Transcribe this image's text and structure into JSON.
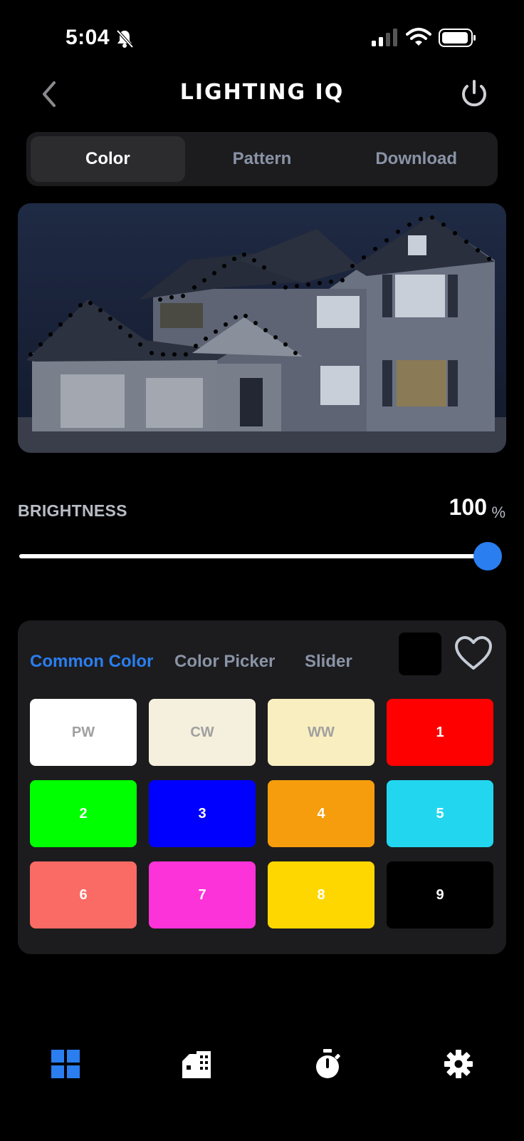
{
  "status_bar": {
    "time": "5:04"
  },
  "header": {
    "title": "LIGHTING IQ"
  },
  "mode_tabs": [
    {
      "label": "Color",
      "active": true
    },
    {
      "label": "Pattern",
      "active": false
    },
    {
      "label": "Download",
      "active": false
    }
  ],
  "brightness": {
    "label": "BRIGHTNESS",
    "value": "100",
    "unit": "%",
    "level": 1.0
  },
  "color_panel": {
    "tabs": [
      {
        "label": "Common Color",
        "active": true
      },
      {
        "label": "Color Picker",
        "active": false
      },
      {
        "label": "Slider",
        "active": false
      }
    ],
    "current_color": "#000000",
    "swatches": [
      {
        "label": "PW",
        "color": "#ffffff"
      },
      {
        "label": "CW",
        "color": "#f5efdd"
      },
      {
        "label": "WW",
        "color": "#f8eebf"
      },
      {
        "label": "1",
        "color": "#ff0000"
      },
      {
        "label": "2",
        "color": "#00ff00"
      },
      {
        "label": "3",
        "color": "#0000ff"
      },
      {
        "label": "4",
        "color": "#f59d0c"
      },
      {
        "label": "5",
        "color": "#23d6ef"
      },
      {
        "label": "6",
        "color": "#fa6b66"
      },
      {
        "label": "7",
        "color": "#fb33d8"
      },
      {
        "label": "8",
        "color": "#ffd700"
      },
      {
        "label": "9",
        "color": "#000000"
      }
    ]
  },
  "colors": {
    "accent": "#2a7ef0",
    "panel": "#1c1c1e",
    "inactive_text": "#8a93a6"
  },
  "bottom_nav": [
    {
      "icon": "dashboard-grid-icon",
      "active": true
    },
    {
      "icon": "building-icon",
      "active": false
    },
    {
      "icon": "timer-icon",
      "active": false
    },
    {
      "icon": "settings-gear-icon",
      "active": false
    }
  ]
}
